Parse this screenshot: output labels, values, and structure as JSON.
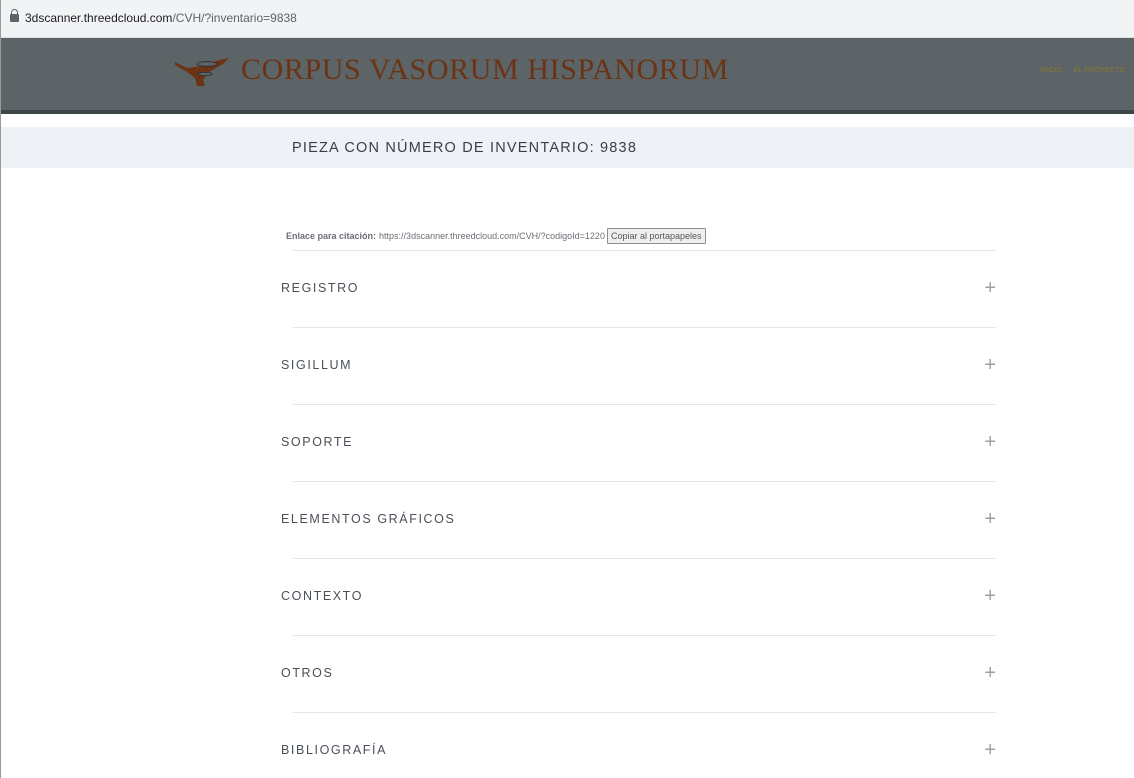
{
  "browser": {
    "url_host": "3dscanner.threedcloud.com",
    "url_path": "/CVH/?inventario=9838"
  },
  "header": {
    "site_title": "CORPUS VASORUM HISPANORUM",
    "nav": [
      "INICIO",
      "EL PROYECTO"
    ],
    "logo_icon": "vase-logo-icon"
  },
  "page": {
    "title": "PIEZA CON NÚMERO DE INVENTARIO: 9838",
    "citation_label": "Enlace para citación:",
    "citation_url": "https://3dscanner.threedcloud.com/CVH/?codigoId=1220",
    "copy_button": "Copiar al portapapeles"
  },
  "sections": [
    {
      "label": "REGISTRO",
      "icon": "plus-icon"
    },
    {
      "label": "SIGILLUM",
      "icon": "plus-icon"
    },
    {
      "label": "SOPORTE",
      "icon": "plus-icon"
    },
    {
      "label": "ELEMENTOS GRÁFICOS",
      "icon": "plus-icon"
    },
    {
      "label": "CONTEXTO",
      "icon": "plus-icon"
    },
    {
      "label": "OTROS",
      "icon": "plus-icon"
    },
    {
      "label": "BIBLIOGRAFÍA",
      "icon": "plus-icon"
    }
  ],
  "plus_symbol": "+",
  "colors": {
    "header_bg": "#5c6467",
    "title_color": "#6b3314",
    "band_bg": "#eef2f6"
  }
}
